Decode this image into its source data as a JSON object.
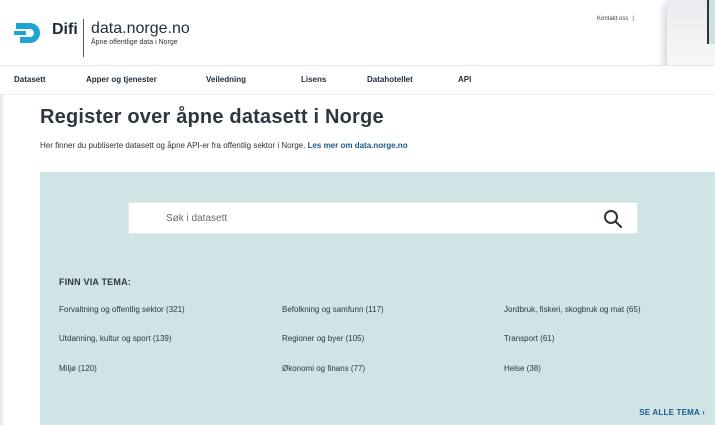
{
  "header": {
    "brand": "Difi",
    "site_name": "data.norge.no",
    "tagline": "Åpne offentlige data i Norge",
    "contact_link": "Kontakt oss",
    "separator": "|"
  },
  "nav": {
    "items": [
      {
        "label": "Datasett"
      },
      {
        "label": "Apper og tjenester"
      },
      {
        "label": "Veiledning"
      },
      {
        "label": "Lisens"
      },
      {
        "label": "Datahotellet"
      },
      {
        "label": "API"
      }
    ]
  },
  "main": {
    "title": "Register over åpne datasett i Norge",
    "intro_text": "Her finner du publiserte datasett og åpne API-er fra offentlig sektor i Norge. ",
    "intro_link": "Les mer om data.norge.no"
  },
  "search": {
    "placeholder": "Søk i datasett",
    "icon": "search-icon"
  },
  "themes": {
    "heading": "FINN VIA TEMA:",
    "items": [
      {
        "label": "Forvaltning og offentlig sektor (321)"
      },
      {
        "label": "Befolkning og samfunn (117)"
      },
      {
        "label": "Jordbruk, fiskeri, skogbruk og mat (65)"
      },
      {
        "label": "Utdanning, kultur og sport (139)"
      },
      {
        "label": "Regioner og byer (105)"
      },
      {
        "label": "Transport (61)"
      },
      {
        "label": "Miljø (120)"
      },
      {
        "label": "Økonomi og finans (77)"
      },
      {
        "label": "Helse (38)"
      }
    ],
    "see_all": "SE ALLE TEMA ›"
  },
  "colors": {
    "panel_bg": "#d0e4e6",
    "logo_blue": "#1fa2d6",
    "link": "#1a5a8a"
  }
}
